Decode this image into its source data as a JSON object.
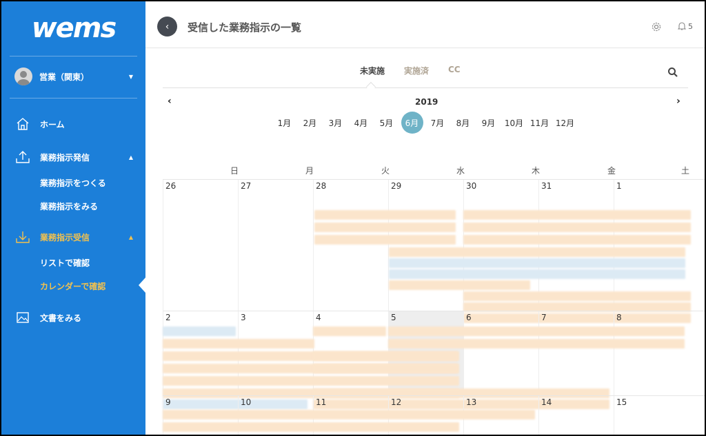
{
  "app": {
    "logo": "wems"
  },
  "sidebar": {
    "user": "営業（関東）",
    "nav": {
      "home": "ホーム",
      "send": "業務指示発信",
      "send_create": "業務指示をつくる",
      "send_view": "業務指示をみる",
      "receive": "業務指示受信",
      "receive_list": "リストで確認",
      "receive_calendar": "カレンダーで確認",
      "docs": "文書をみる"
    }
  },
  "header": {
    "title": "受信した業務指示の一覧",
    "notification_count": "5"
  },
  "tabs": [
    {
      "label": "未実施",
      "active": true
    },
    {
      "label": "実施済",
      "active": false
    },
    {
      "label": "CC",
      "active": false
    }
  ],
  "calendar": {
    "year": "2019",
    "months": [
      "1月",
      "2月",
      "3月",
      "4月",
      "5月",
      "6月",
      "7月",
      "8月",
      "9月",
      "10月",
      "11月",
      "12月"
    ],
    "active_month": "6月",
    "weekdays": [
      "日",
      "月",
      "火",
      "水",
      "木",
      "金",
      "土"
    ],
    "weeks": [
      [
        "26",
        "27",
        "28",
        "29",
        "30",
        "31",
        "1"
      ],
      [
        "2",
        "3",
        "4",
        "5",
        "6",
        "7",
        "8"
      ],
      [
        "9",
        "10",
        "11",
        "12",
        "13",
        "14",
        "15"
      ]
    ]
  },
  "colors": {
    "sidebar_bg": "#1c7fd9",
    "accent": "#f2c14e",
    "month_active": "#6fb3c7",
    "event_orange": "#fbe5cc",
    "event_blue": "#dceaf4"
  }
}
